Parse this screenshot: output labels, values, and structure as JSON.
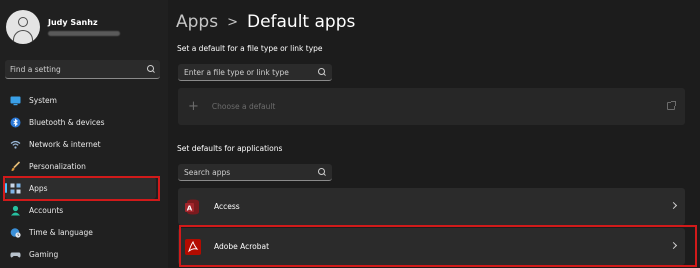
{
  "profile": {
    "name": "Judy Sanhz"
  },
  "sidebar": {
    "search_placeholder": "Find a setting",
    "items": [
      {
        "label": "System",
        "icon": "monitor-icon"
      },
      {
        "label": "Bluetooth & devices",
        "icon": "bluetooth-icon"
      },
      {
        "label": "Network & internet",
        "icon": "wifi-icon"
      },
      {
        "label": "Personalization",
        "icon": "brush-icon"
      },
      {
        "label": "Apps",
        "icon": "apps-icon",
        "selected": true
      },
      {
        "label": "Accounts",
        "icon": "person-icon"
      },
      {
        "label": "Time & language",
        "icon": "globe-clock-icon"
      },
      {
        "label": "Gaming",
        "icon": "controller-icon"
      }
    ]
  },
  "header": {
    "parent": "Apps",
    "separator": ">",
    "current": "Default apps"
  },
  "filetype_section": {
    "title": "Set a default for a file type or link type",
    "search_placeholder": "Enter a file type or link type",
    "choose_default_label": "Choose a default",
    "plus_glyph": "+"
  },
  "apps_section": {
    "title": "Set defaults for applications",
    "search_placeholder": "Search apps",
    "apps": [
      {
        "name": "Access",
        "icon": "access-icon"
      },
      {
        "name": "Adobe Acrobat",
        "icon": "acrobat-icon",
        "highlighted": true
      }
    ]
  },
  "colors": {
    "accent": "#4cc2ff",
    "highlight_border": "#d11a1a",
    "background": "#1c1c1c",
    "card": "#2b2b2b"
  }
}
